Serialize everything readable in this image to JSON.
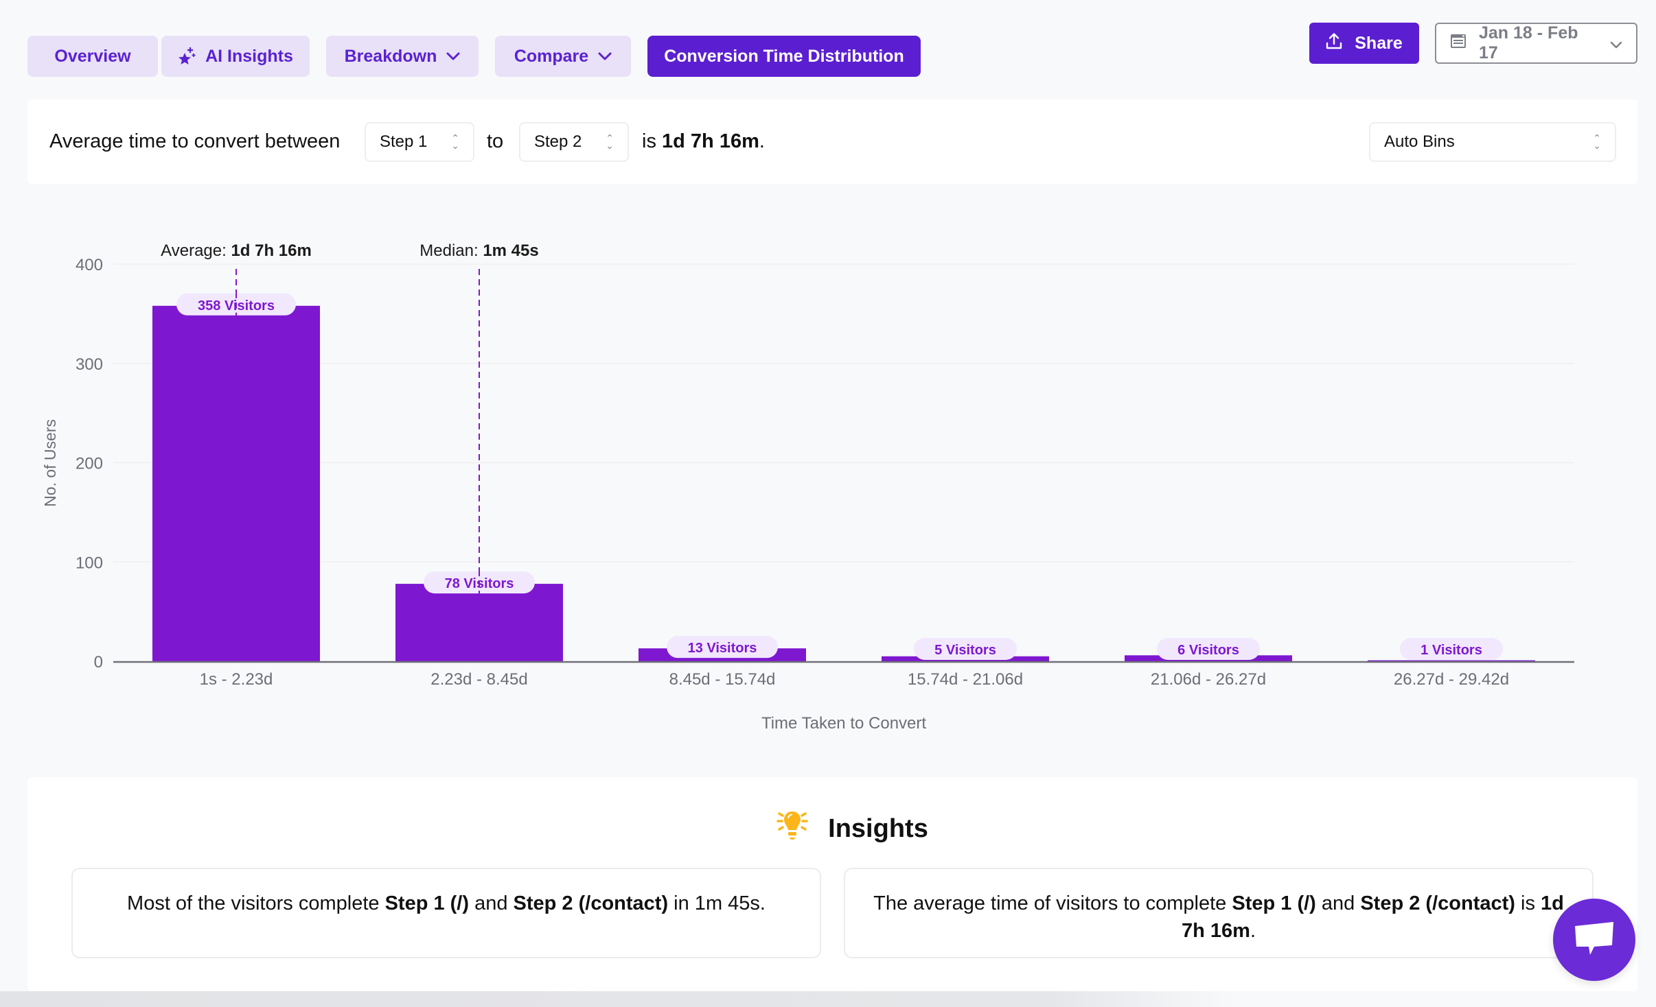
{
  "tabs": [
    {
      "label": "Overview",
      "icon": null,
      "active": false
    },
    {
      "label": "AI Insights",
      "icon": "sparkle-stars-icon",
      "active": false
    },
    {
      "label": "Breakdown",
      "icon": "chevron-down-icon",
      "active": false
    },
    {
      "label": "Compare",
      "icon": "chevron-down-icon",
      "active": false
    },
    {
      "label": "Conversion Time Distribution",
      "icon": null,
      "active": true
    }
  ],
  "header": {
    "share_label": "Share",
    "date_range": "Jan 18 - Feb 17"
  },
  "config": {
    "prefix": "Average time to convert between",
    "from_step": "Step 1",
    "connector": "to",
    "to_step": "Step 2",
    "result_prefix": "is",
    "result_value": "1d 7h 16m",
    "result_suffix": ".",
    "bins": "Auto Bins"
  },
  "colors": {
    "accent": "#5b1fd1",
    "bar": "#7e17d0",
    "label_bg": "#f1e8fd",
    "insight_icon": "#fbb51b"
  },
  "chart_data": {
    "type": "bar",
    "title": "",
    "xlabel": "Time Taken to Convert",
    "ylabel": "No. of Users",
    "ylim": [
      0,
      400
    ],
    "yticks": [
      0,
      100,
      200,
      300,
      400
    ],
    "grid": true,
    "categories": [
      "1s - 2.23d",
      "2.23d - 8.45d",
      "8.45d - 15.74d",
      "15.74d - 21.06d",
      "21.06d - 26.27d",
      "26.27d - 29.42d"
    ],
    "values": [
      358,
      78,
      13,
      5,
      6,
      1
    ],
    "data_labels": [
      "358 Visitors",
      "78 Visitors",
      "13 Visitors",
      "5 Visitors",
      "6 Visitors",
      "1 Visitors"
    ],
    "annotations": [
      {
        "label": "Average:",
        "value": "1d 7h 16m",
        "category_index": 0
      },
      {
        "label": "Median:",
        "value": "1m 45s",
        "category_index": 1
      }
    ]
  },
  "insights": {
    "title": "Insights",
    "icon": "lightbulb-icon",
    "cards": [
      {
        "parts": [
          {
            "t": "Most of the visitors complete ",
            "b": false
          },
          {
            "t": "Step 1 (/)",
            "b": true
          },
          {
            "t": " and ",
            "b": false
          },
          {
            "t": "Step 2 (/contact)",
            "b": true
          },
          {
            "t": " in 1m 45s.",
            "b": false
          }
        ]
      },
      {
        "parts": [
          {
            "t": "The average time of visitors to complete ",
            "b": false
          },
          {
            "t": "Step 1 (/)",
            "b": true
          },
          {
            "t": " and ",
            "b": false
          },
          {
            "t": "Step 2 (/contact)",
            "b": true
          },
          {
            "t": " is ",
            "b": false
          },
          {
            "t": "1d 7h 16m",
            "b": true
          },
          {
            "t": ".",
            "b": false
          }
        ]
      }
    ]
  },
  "chat": {
    "icon": "chat-bubble-icon"
  }
}
